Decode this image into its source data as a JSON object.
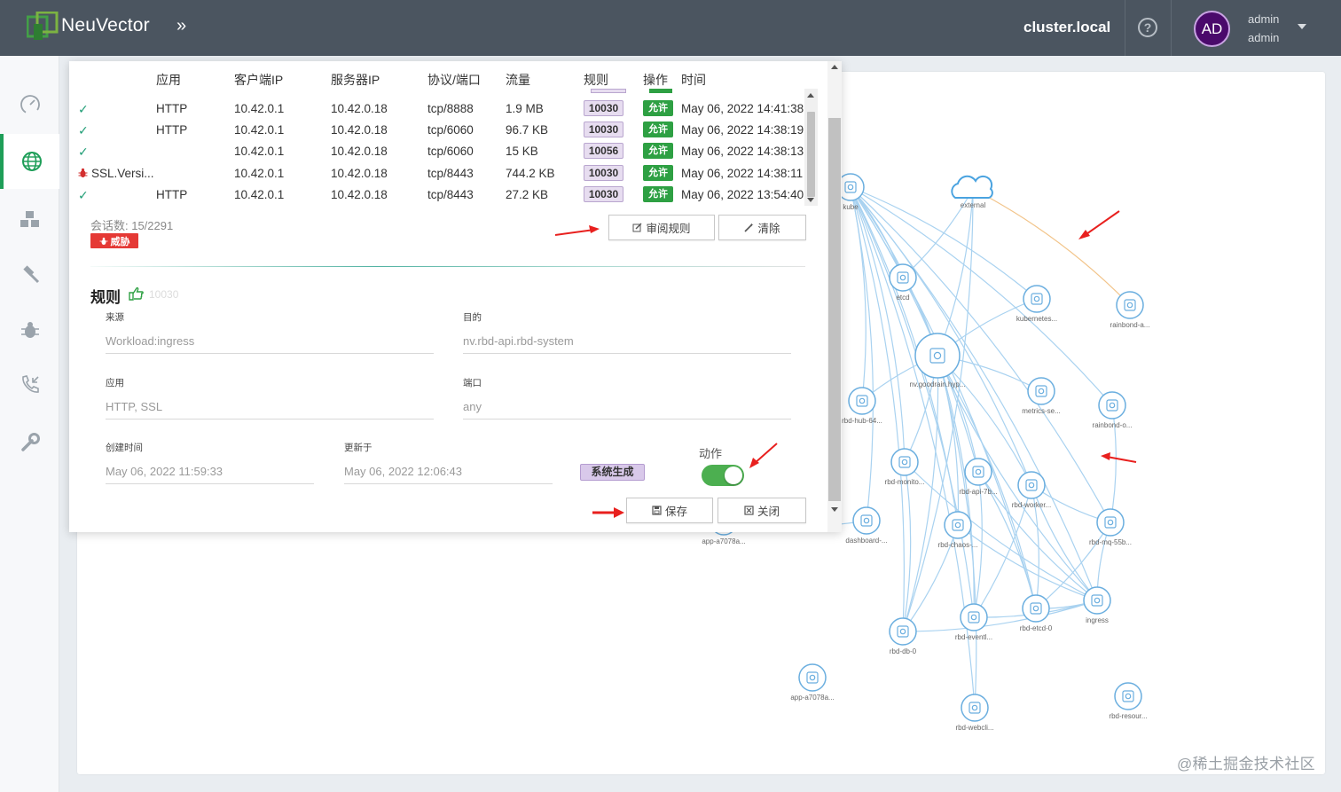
{
  "header": {
    "brand": "NeuVector",
    "expand_icon": "»",
    "cluster": "cluster.local",
    "help_icon": "?",
    "avatar_initials": "AD",
    "user_name": "admin",
    "user_role": "admin"
  },
  "sidebar": {
    "items": [
      {
        "name": "dashboard",
        "icon": "speedometer-icon"
      },
      {
        "name": "network",
        "icon": "globe-icon",
        "active": true
      },
      {
        "name": "assets",
        "icon": "cubes-icon"
      },
      {
        "name": "policy",
        "icon": "gavel-icon"
      },
      {
        "name": "security-events",
        "icon": "bug-icon"
      },
      {
        "name": "notifications",
        "icon": "phone-incoming-icon"
      },
      {
        "name": "settings",
        "icon": "wrench-icon"
      }
    ]
  },
  "colors": {
    "topbar": "#4b5560",
    "accent_green": "#1e9e58",
    "allow": "#2ea043",
    "threat": "#e53935",
    "node": "#6aaedf"
  },
  "table": {
    "headers": [
      "应用",
      "客户端IP",
      "服务器IP",
      "协议/端口",
      "流量",
      "规则",
      "操作",
      "时间"
    ],
    "rows": [
      {
        "status": "✓",
        "app": "HTTP",
        "client": "10.42.0.1",
        "server": "10.42.0.18",
        "port": "tcp/8888",
        "bytes": "1.9 MB",
        "rule": "10030",
        "action": "允许",
        "time": "May 06, 2022 14:41:38"
      },
      {
        "status": "✓",
        "app": "HTTP",
        "client": "10.42.0.1",
        "server": "10.42.0.18",
        "port": "tcp/6060",
        "bytes": "96.7 KB",
        "rule": "10030",
        "action": "允许",
        "time": "May 06, 2022 14:38:19"
      },
      {
        "status": "✓",
        "app": "",
        "client": "10.42.0.1",
        "server": "10.42.0.18",
        "port": "tcp/6060",
        "bytes": "15 KB",
        "rule": "10056",
        "action": "允许",
        "time": "May 06, 2022 14:38:13"
      },
      {
        "status": "bug",
        "app": "SSL.Versi...",
        "client": "10.42.0.1",
        "server": "10.42.0.18",
        "port": "tcp/8443",
        "bytes": "744.2 KB",
        "rule": "10030",
        "action": "允许",
        "time": "May 06, 2022 14:38:11"
      },
      {
        "status": "✓",
        "app": "HTTP",
        "client": "10.42.0.1",
        "server": "10.42.0.18",
        "port": "tcp/8443",
        "bytes": "27.2 KB",
        "rule": "10030",
        "action": "允许",
        "time": "May 06, 2022 13:54:40"
      }
    ]
  },
  "session": {
    "count_label": "会话数: 15/2291",
    "threat_label": "威胁",
    "review_button": "审阅规则",
    "clear_button": "清除"
  },
  "rule": {
    "title": "规则",
    "id": "10030",
    "source_label": "来源",
    "source_value": "Workload:ingress",
    "dest_label": "目的",
    "dest_value": "nv.rbd-api.rbd-system",
    "app_label": "应用",
    "app_value": "HTTP, SSL",
    "port_label": "端口",
    "port_value": "any",
    "created_label": "创建时间",
    "created_value": "May 06, 2022 11:59:33",
    "updated_label": "更新于",
    "updated_value": "May 06, 2022 12:06:43",
    "system_badge": "系统生成",
    "action_label": "动作",
    "action_enabled": true,
    "save_button": "保存",
    "close_button": "关闭"
  },
  "graph": {
    "nodes": [
      {
        "label": "kube"
      },
      {
        "label": "external"
      },
      {
        "label": "etcd"
      },
      {
        "label": "kubernetes..."
      },
      {
        "label": "rainbond-a..."
      },
      {
        "label": "nv.goodrain.hyp..."
      },
      {
        "label": "rbd-hub-64..."
      },
      {
        "label": "metrics-se..."
      },
      {
        "label": "rainbond-o..."
      },
      {
        "label": "rbd-monito..."
      },
      {
        "label": "rbd-api-7b..."
      },
      {
        "label": "rbd-worker..."
      },
      {
        "label": "dashboard-..."
      },
      {
        "label": "rbd-chaos-..."
      },
      {
        "label": "rbd-mq-55b..."
      },
      {
        "label": "app-a7078a..."
      },
      {
        "label": "rbd-eventl..."
      },
      {
        "label": "rbd-etcd-0"
      },
      {
        "label": "ingress"
      },
      {
        "label": "rbd-db-0"
      },
      {
        "label": "app-a7078a..."
      },
      {
        "label": "rbd-webcli..."
      },
      {
        "label": "rbd-resour..."
      }
    ]
  },
  "watermark": "@稀土掘金技术社区"
}
